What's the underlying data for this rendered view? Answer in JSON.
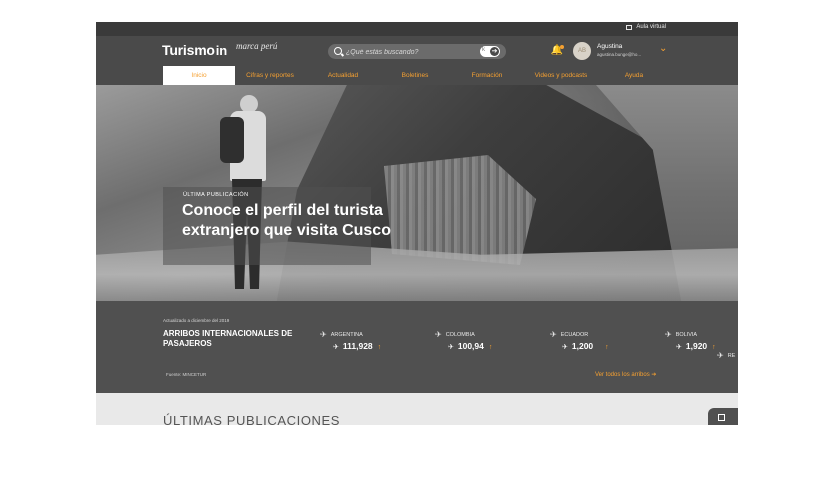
{
  "topbar": {
    "aula_label": "Aula virtual"
  },
  "header": {
    "logo_text": "Turismo",
    "logo_suffix": "in",
    "peru_brand": "marca perú",
    "search_placeholder": "¿Qué estás buscando?",
    "search_shortcut": "k",
    "user_name": "Agustina",
    "user_email": "agustina.bunge@ho...",
    "avatar_initials": "AB"
  },
  "nav": {
    "items": [
      {
        "label": "Inicio",
        "active": true
      },
      {
        "label": "Cifras y reportes"
      },
      {
        "label": "Actualidad"
      },
      {
        "label": "Boletines"
      },
      {
        "label": "Formación"
      },
      {
        "label": "Videos y podcasts"
      },
      {
        "label": "Ayuda"
      }
    ]
  },
  "hero": {
    "eyebrow": "ÚLTIMA PUBLICACIÓN",
    "title": "Conoce el perfil del turista extranjero que visita Cusco",
    "slides_total": 4,
    "active_slide": 1
  },
  "stats": {
    "updated": "Actualizado a diciembre del 2019",
    "title": "ARRIBOS INTERNACIONALES DE PASAJEROS",
    "countries": [
      {
        "name": "ARGENTINA",
        "value": "111,928"
      },
      {
        "name": "COLOMBIA",
        "value": "100,94"
      },
      {
        "name": "ECUADOR",
        "value": "1,200"
      },
      {
        "name": "BOLIVIA",
        "value": "1,920"
      },
      {
        "name": "RE"
      }
    ],
    "source": "Fuente: MINCETUR",
    "see_all": "Ver todos los arribos"
  },
  "latest": {
    "title": "ÚLTIMAS PUBLICACIONES"
  },
  "colors": {
    "accent": "#f5a031",
    "dark": "#4a4a4a",
    "band": "#505050"
  }
}
